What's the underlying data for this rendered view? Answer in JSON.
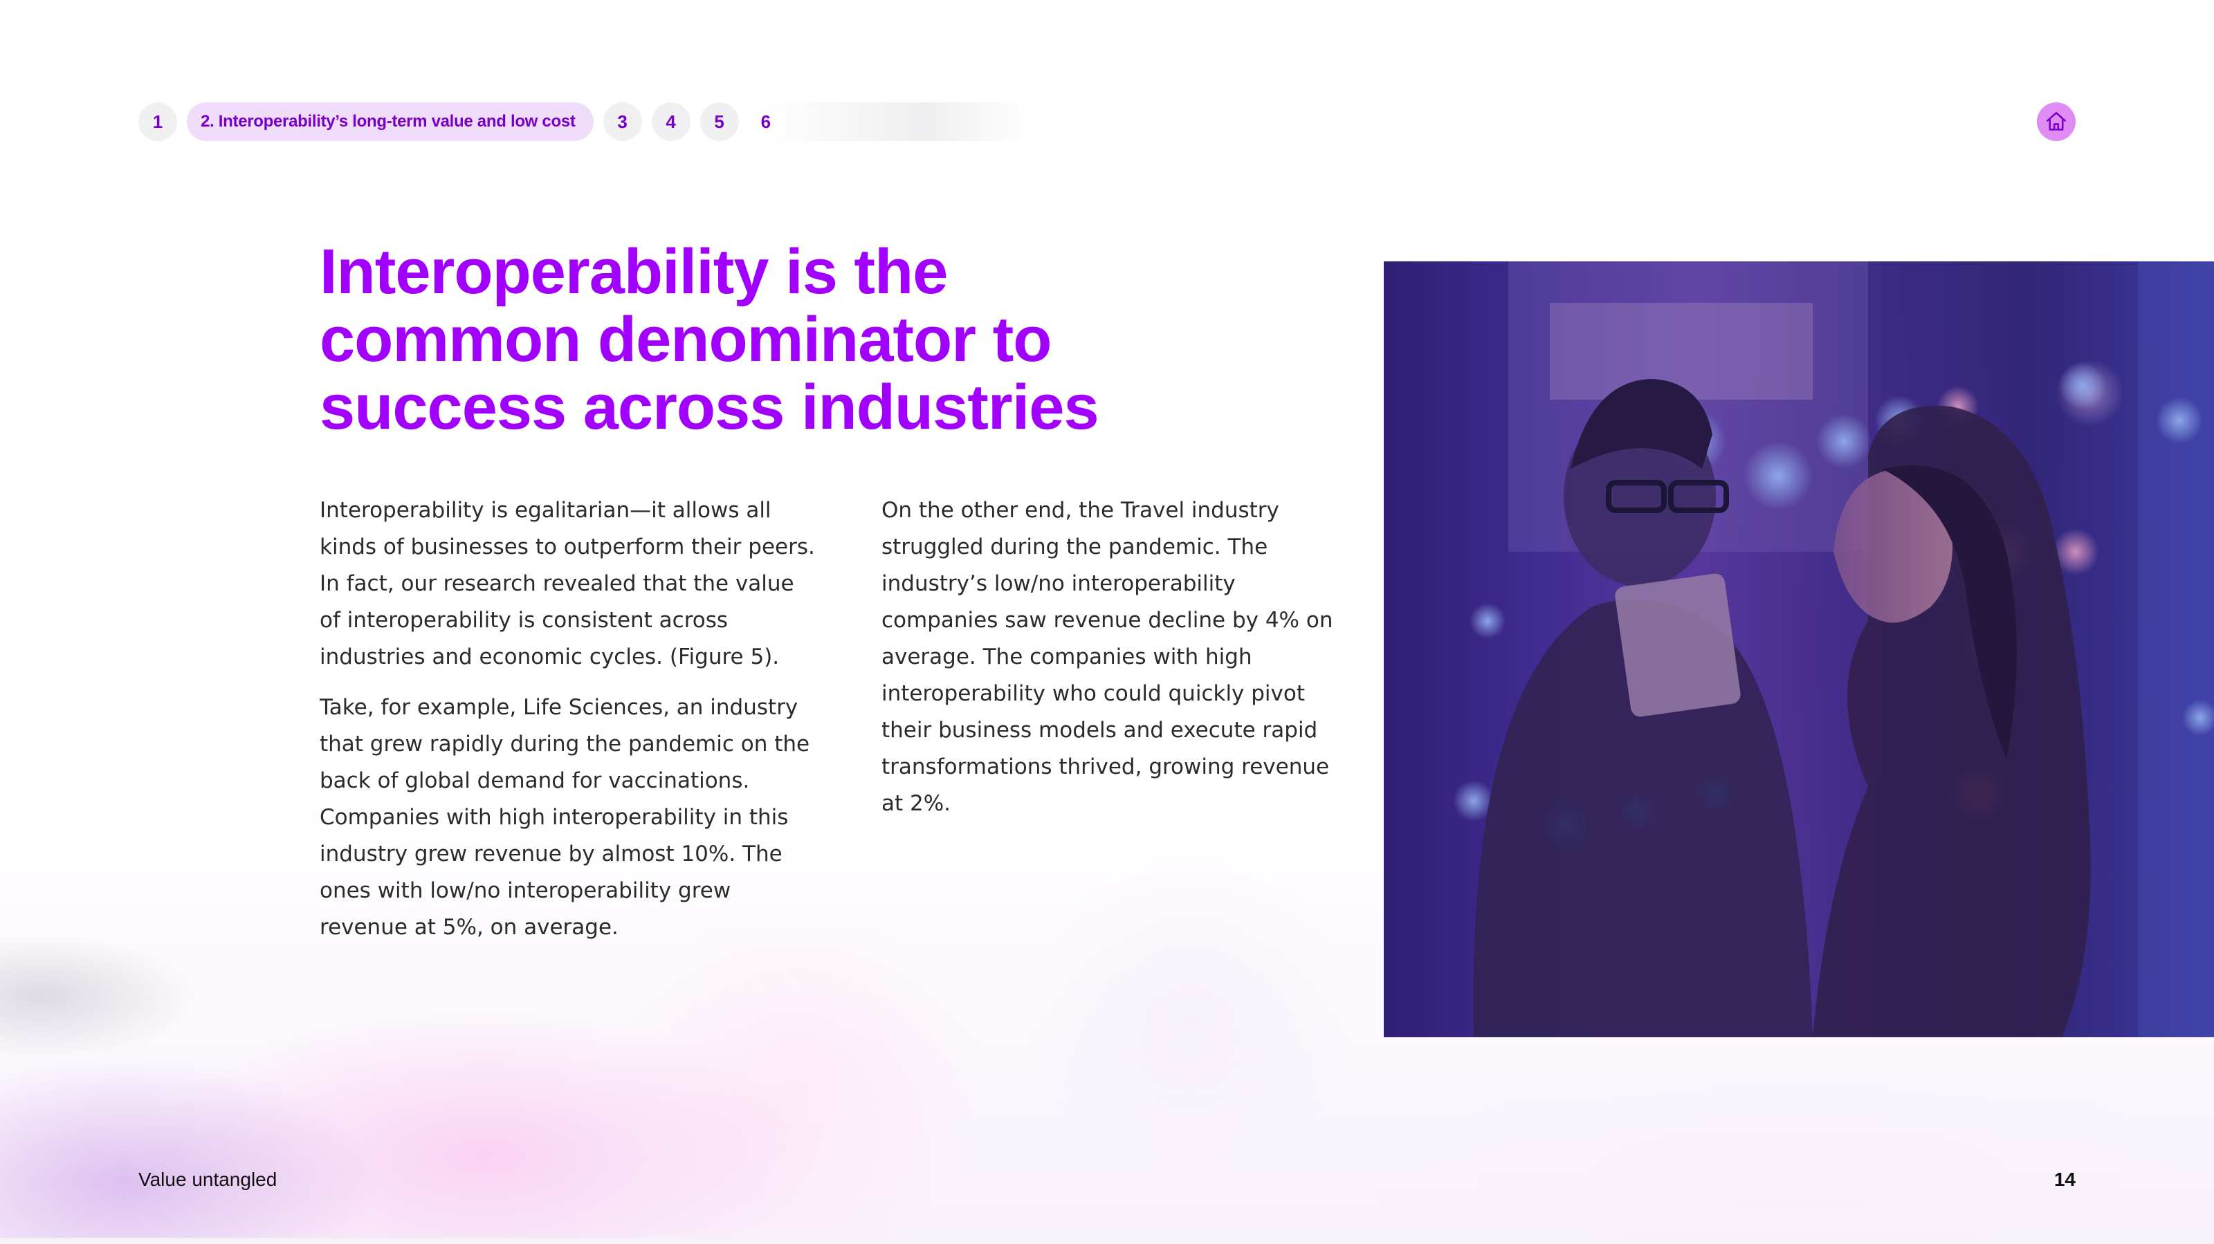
{
  "nav": {
    "items": [
      {
        "label": "1"
      },
      {
        "label": "2. Interoperability’s long-term value and low cost"
      },
      {
        "label": "3"
      },
      {
        "label": "4"
      },
      {
        "label": "5"
      },
      {
        "label": "6"
      }
    ],
    "home_icon": "home-icon"
  },
  "heading": {
    "line1": "Interoperability is the",
    "line2": "common denominator to",
    "line3": "success across industries"
  },
  "body": {
    "left": {
      "p1": "Interoperability is egalitarian—it allows all kinds of businesses to outperform their peers. In fact, our research revealed that the value of interoperability is consistent across industries and economic cycles. (Figure 5).",
      "p2": "Take, for example, Life Sciences, an industry that grew rapidly during the pandemic on the back of global demand for vaccinations. Companies with high interoperability in this industry grew revenue by almost 10%. The ones with low/no interoperability grew revenue at 5%, on average."
    },
    "right": {
      "p1": "On the other end, the Travel industry struggled during the pandemic. The industry’s low/no interoperability companies saw revenue decline by 4% on average. The companies with high interoperability who could quickly pivot their business models and execute rapid transformations thrived, growing revenue at 2%."
    }
  },
  "footer": {
    "title": "Value untangled",
    "page_number": "14"
  },
  "colors": {
    "accent": "#a100ff",
    "nav_text": "#7a00c8",
    "active_pill": "#f0dcfb",
    "home_button": "#df8cf4"
  }
}
